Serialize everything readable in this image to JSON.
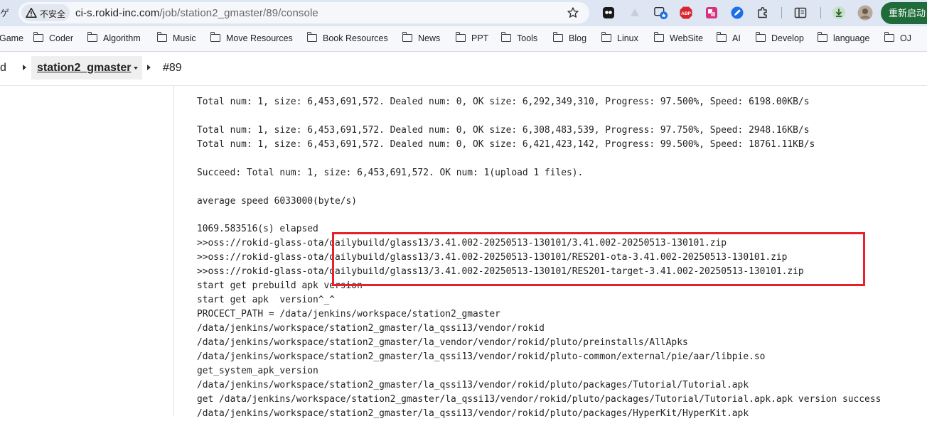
{
  "browser": {
    "edge_glyph": "ゲ",
    "security_label": "不安全",
    "url_host": "ci-s.rokid-inc.com",
    "url_path": "/job/station2_gmaster/89/console",
    "restart_label": "重新启动",
    "extensions": [
      "ext-icon",
      "triangle-icon",
      "translate-badge-icon",
      "abp-icon",
      "translate-icon",
      "pen-icon",
      "puzzle-icon",
      "reading-list-icon",
      "download-icon",
      "avatar"
    ]
  },
  "bookmarks": [
    {
      "label": "Game"
    },
    {
      "label": "Coder"
    },
    {
      "label": "Algorithm"
    },
    {
      "label": "Music"
    },
    {
      "label": "Move Resources"
    },
    {
      "label": "Book Resources"
    },
    {
      "label": "News"
    },
    {
      "label": "PPT"
    },
    {
      "label": "Tools"
    },
    {
      "label": "Blog"
    },
    {
      "label": "Linux"
    },
    {
      "label": "WebSite"
    },
    {
      "label": "AI"
    },
    {
      "label": "Develop"
    },
    {
      "label": "language"
    },
    {
      "label": "OJ"
    }
  ],
  "breadcrumb": {
    "prev": "d",
    "job": "station2_gmaster",
    "build": "#89"
  },
  "console": {
    "lines": [
      "Total num: 1, size: 6,453,691,572. Dealed num: 0, OK size: 6,292,349,310, Progress: 97.500%, Speed: 6198.00KB/s",
      "",
      "Total num: 1, size: 6,453,691,572. Dealed num: 0, OK size: 6,308,483,539, Progress: 97.750%, Speed: 2948.16KB/s",
      "Total num: 1, size: 6,453,691,572. Dealed num: 0, OK size: 6,421,423,142, Progress: 99.500%, Speed: 18761.11KB/s",
      "",
      "Succeed: Total num: 1, size: 6,453,691,572. OK num: 1(upload 1 files).",
      "",
      "average speed 6033000(byte/s)",
      "",
      "1069.583516(s) elapsed",
      ">>oss://rokid-glass-ota/dailybuild/glass13/3.41.002-20250513-130101/3.41.002-20250513-130101.zip",
      ">>oss://rokid-glass-ota/dailybuild/glass13/3.41.002-20250513-130101/RES201-ota-3.41.002-20250513-130101.zip",
      ">>oss://rokid-glass-ota/dailybuild/glass13/3.41.002-20250513-130101/RES201-target-3.41.002-20250513-130101.zip",
      "start get prebuild apk version",
      "start get apk  version^_^",
      "PROCECT_PATH = /data/jenkins/workspace/station2_gmaster",
      "/data/jenkins/workspace/station2_gmaster/la_qssi13/vendor/rokid",
      "/data/jenkins/workspace/station2_gmaster/la_vendor/vendor/rokid/pluto/preinstalls/AllApks",
      "/data/jenkins/workspace/station2_gmaster/la_qssi13/vendor/rokid/pluto-common/external/pie/aar/libpie.so",
      "get_system_apk_version",
      "/data/jenkins/workspace/station2_gmaster/la_qssi13/vendor/rokid/pluto/packages/Tutorial/Tutorial.apk",
      "get /data/jenkins/workspace/station2_gmaster/la_qssi13/vendor/rokid/pluto/packages/Tutorial/Tutorial.apk.apk version success",
      "/data/jenkins/workspace/station2_gmaster/la_qssi13/vendor/rokid/pluto/packages/HyperKit/HyperKit.apk"
    ]
  },
  "colors": {
    "highlight": "#e8202a",
    "restart_button": "#1f6b3a",
    "topbar": "#dfe6f3"
  }
}
